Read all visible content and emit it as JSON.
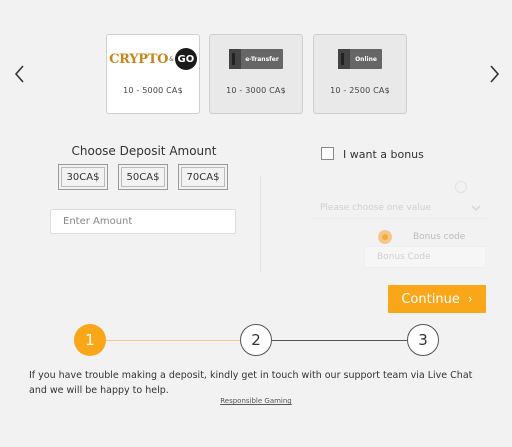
{
  "carousel": {
    "prev_icon": "chevron-left-icon",
    "next_icon": "chevron-right-icon",
    "methods": [
      {
        "logo_text_1": "CRYPTO",
        "logo_amp": "&",
        "logo_text_2": "GO",
        "range": "10 - 5000 CA$",
        "selected": true
      },
      {
        "logo_text": "e-Transfer",
        "range": "10 - 3000 CA$",
        "selected": false
      },
      {
        "logo_text": "Online",
        "range": "10 - 2500 CA$",
        "selected": false
      }
    ]
  },
  "deposit": {
    "title": "Choose Deposit Amount",
    "presets": [
      "30CA$",
      "50CA$",
      "70CA$"
    ],
    "amount_placeholder": "Enter Amount",
    "amount_value": ""
  },
  "bonus": {
    "checkbox_label": "I want a bonus",
    "checked": false,
    "select_placeholder": "Please choose one value",
    "code_option_label": "Bonus code",
    "code_placeholder": "Bonus Code"
  },
  "actions": {
    "continue_label": "Continue",
    "continue_chevron": "›"
  },
  "steps": [
    {
      "number": "1",
      "active": true
    },
    {
      "number": "2",
      "active": false
    },
    {
      "number": "3",
      "active": false
    }
  ],
  "footer": {
    "help_text": "If you have trouble making a deposit, kindly get in touch with our support team via Live Chat and we will be happy to help.",
    "responsible_gaming_link": "Responsible Gaming"
  },
  "colors": {
    "accent": "#f9a619",
    "background": "#f2f2f2"
  }
}
